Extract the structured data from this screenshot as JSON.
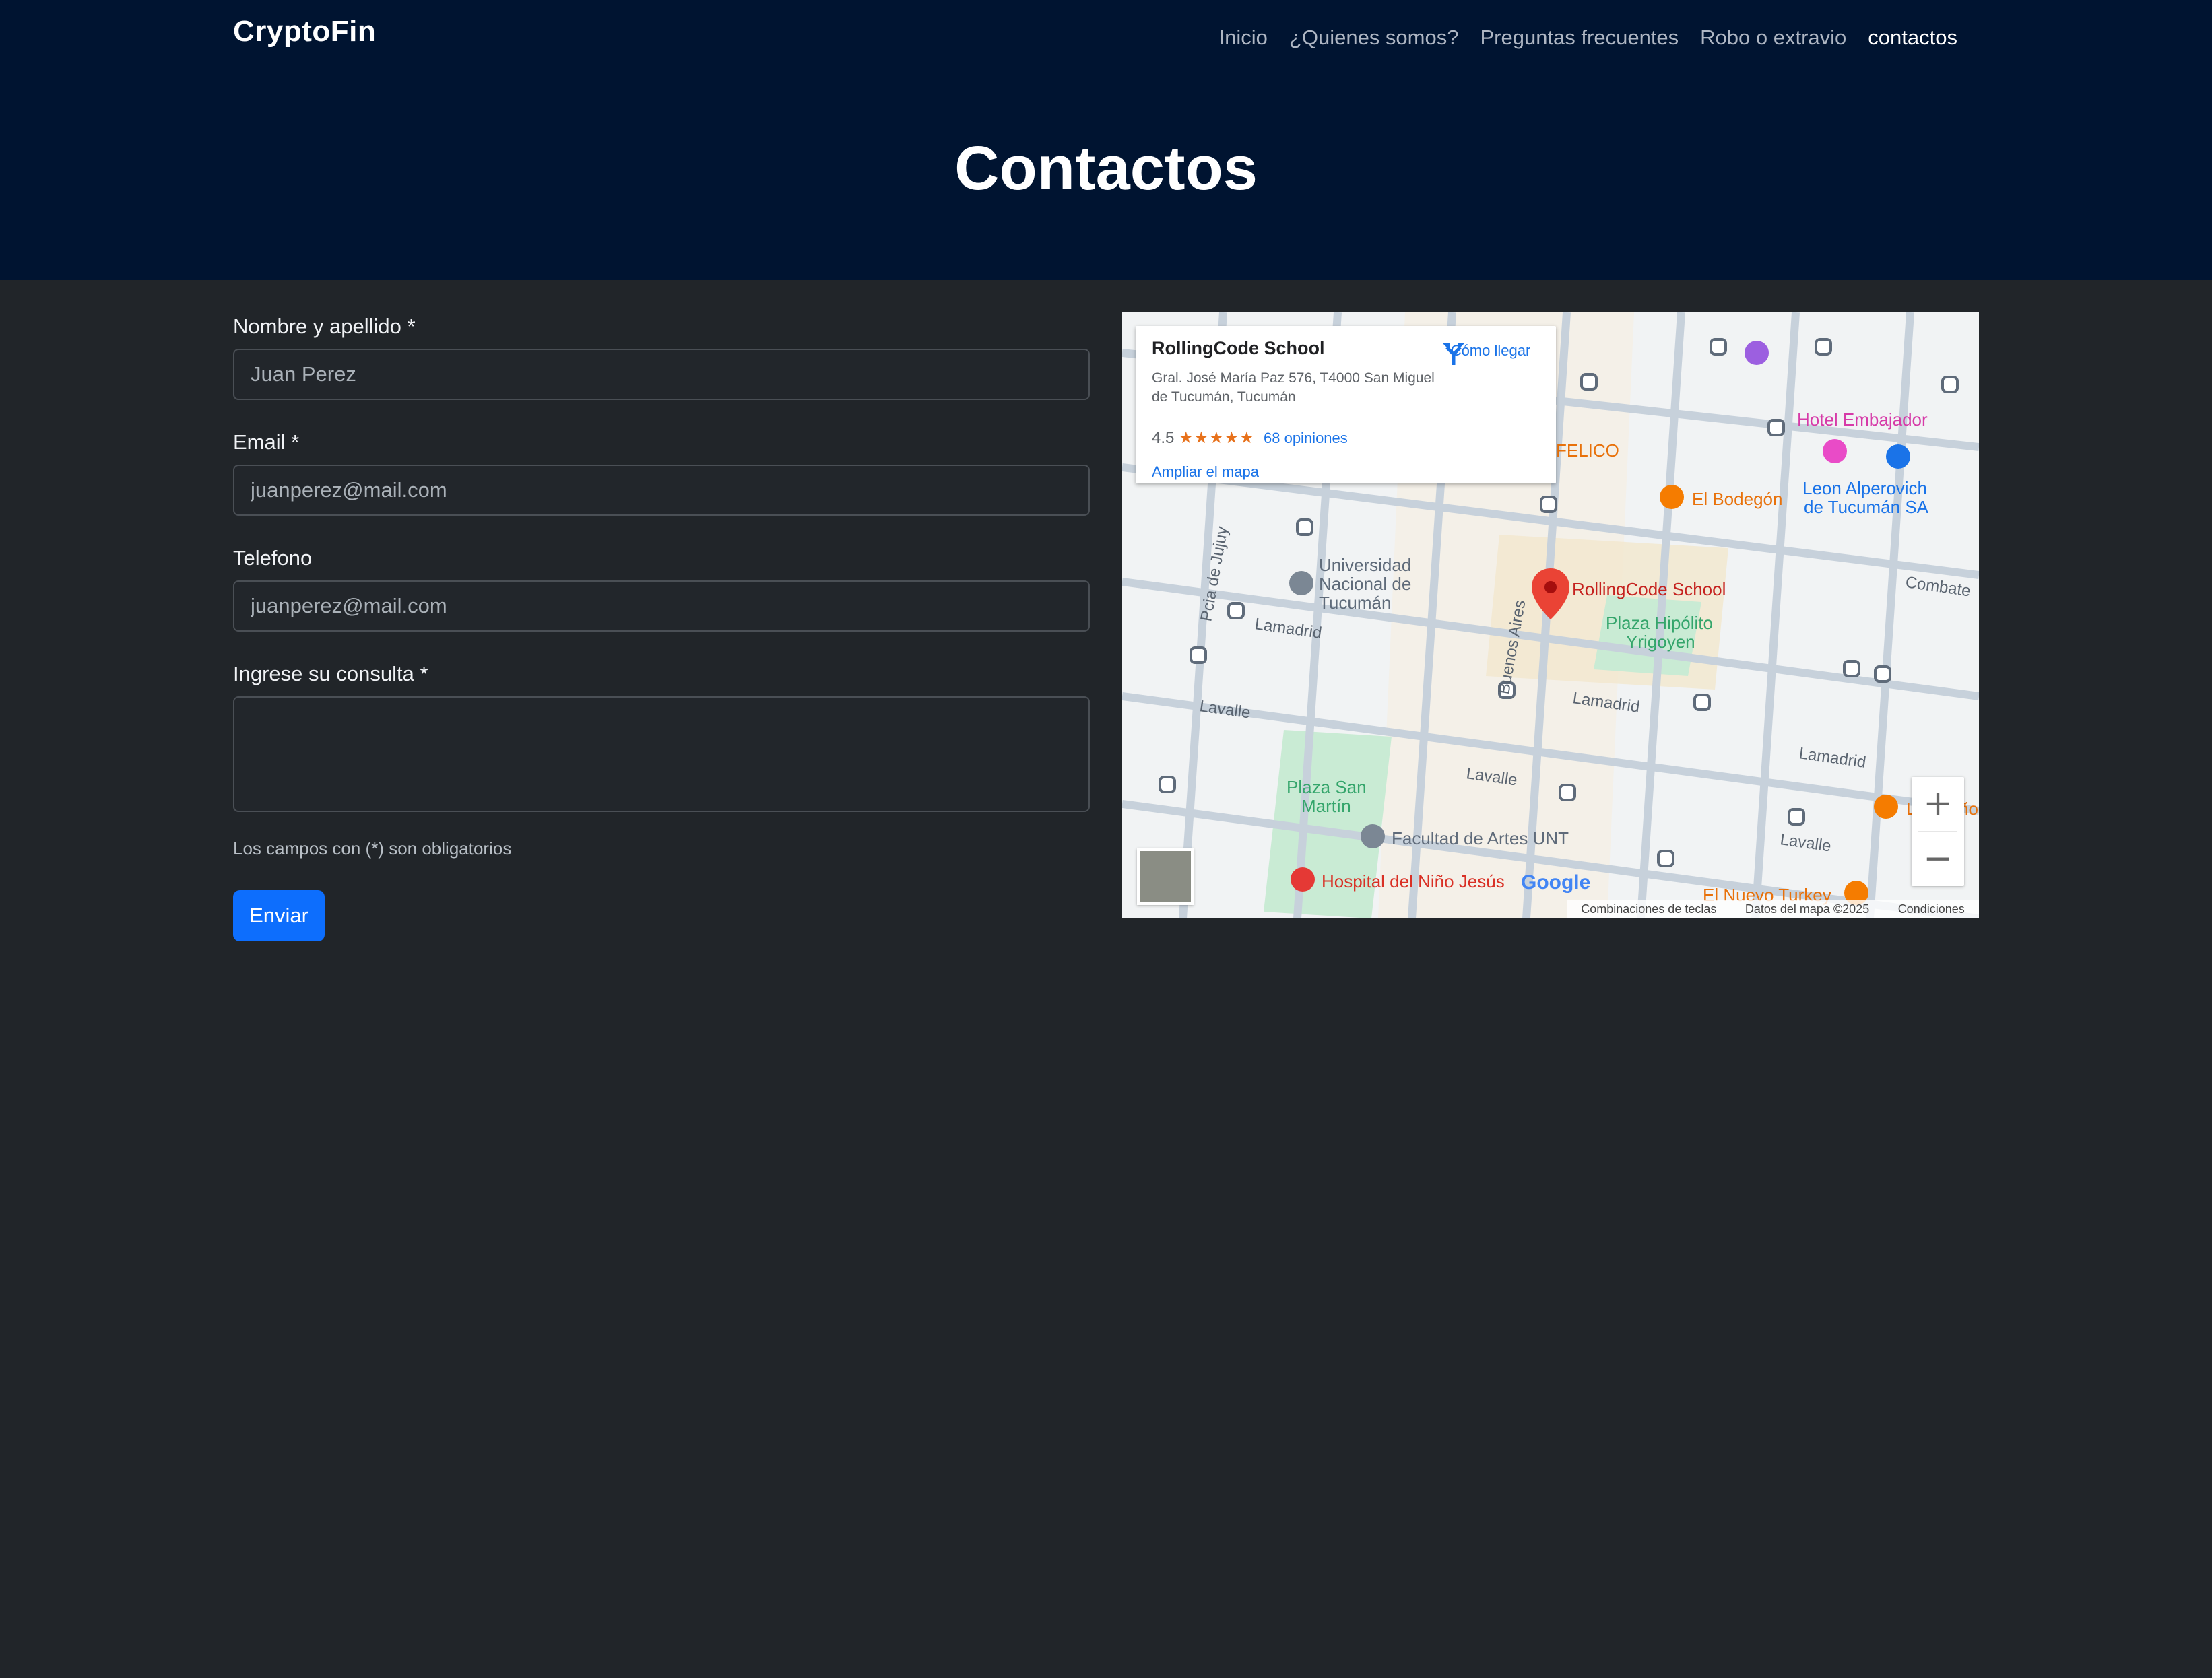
{
  "nav": {
    "brand": "CryptoFin",
    "links": [
      "Inicio",
      "¿Quienes somos?",
      "Preguntas frecuentes",
      "Robo o extravio",
      "contactos"
    ]
  },
  "hero": {
    "title": "Contactos"
  },
  "form": {
    "name_label": "Nombre y apellido *",
    "name_placeholder": "Juan Perez",
    "email_label": "Email *",
    "email_placeholder": "juanperez@mail.com",
    "phone_label": "Telefono",
    "phone_placeholder": "juanperez@mail.com",
    "query_label": "Ingrese su consulta *",
    "query_placeholder": "",
    "required_note": "Los campos con (*) son obligatorios",
    "submit_label": "Enviar"
  },
  "map": {
    "info_title": "RollingCode School",
    "info_address": "Gral. José María Paz 576, T4000 San Miguel de Tucumán, Tucumán",
    "rating": "4.5",
    "stars": "★★★★★",
    "reviews": "68 opiniones",
    "enlarge": "Ampliar el mapa",
    "directions": "Cómo llegar",
    "zoom_in": "+",
    "zoom_out": "−",
    "places": {
      "felico": "FELICO",
      "bodegon": "El Bodegón",
      "hotel": "Hotel Embajador",
      "leon": "Leon Alperovich",
      "leon2": "de Tucumán SA",
      "univ1": "Universidad",
      "univ2": "Nacional de",
      "univ3": "Tucumán",
      "rolling": "RollingCode School",
      "plaza_h1": "Plaza Hipólito",
      "plaza_h2": "Yrigoyen",
      "plaza_sm1": "Plaza San",
      "plaza_sm2": "Martín",
      "artes": "Facultad de Artes UNT",
      "hospital": "Hospital del Niño Jesús",
      "lenos": "Los Leños",
      "turkey": "El Nuevo Turkey",
      "lamadrid": "Lamadrid",
      "lavalle": "Lavalle",
      "combate": "Combate",
      "jujuy": "Pcia de Jujuy",
      "buenos_aires": "Buenos Aires"
    },
    "google": "Google",
    "footer": {
      "shortcuts": "Combinaciones de teclas",
      "data": "Datos del mapa ©2025",
      "terms": "Condiciones"
    }
  }
}
